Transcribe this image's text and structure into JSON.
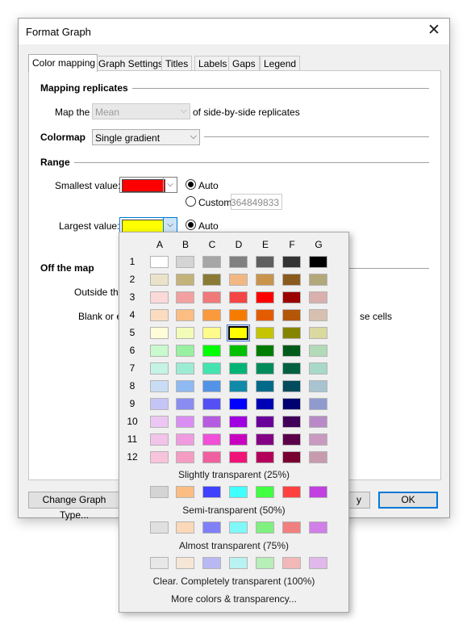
{
  "dialog": {
    "title": "Format Graph"
  },
  "tabs": [
    "Color mapping",
    "Graph Settings",
    "Titles",
    "Labels",
    "Gaps",
    "Legend"
  ],
  "mapping": {
    "section": "Mapping replicates",
    "map_the": "Map the",
    "value": "Mean",
    "suffix": "of side-by-side replicates"
  },
  "colormap": {
    "label": "Colormap",
    "value": "Single gradient"
  },
  "range": {
    "section": "Range",
    "smallest_label": "Smallest value:",
    "smallest_color": "#ff0000",
    "auto": "Auto",
    "custom": "Custom",
    "custom_value": "364849833",
    "largest_label": "Largest value:",
    "largest_color": "#ffff00"
  },
  "offmap": {
    "section": "Off the map",
    "outside": "Outside the",
    "blank": "Blank or ex",
    "blank_suffix": "se cells"
  },
  "buttons": {
    "change_graph_type": "Change Graph Type...",
    "apply": "y",
    "ok": "OK"
  },
  "palette": {
    "columns": [
      "A",
      "B",
      "C",
      "D",
      "E",
      "F",
      "G"
    ],
    "rows": [
      {
        "label": "1",
        "colors": [
          "#ffffff",
          "#d4d4d4",
          "#a6a6a6",
          "#808080",
          "#5f5f5f",
          "#333333",
          "#000000"
        ]
      },
      {
        "label": "2",
        "colors": [
          "#ebe3c9",
          "#c4b27b",
          "#8a7a36",
          "#f2b883",
          "#c8944c",
          "#8b5a1e",
          "#b3a87a"
        ]
      },
      {
        "label": "3",
        "colors": [
          "#fbd9d9",
          "#f3a0a0",
          "#f07a7a",
          "#f54545",
          "#ff0000",
          "#9b0000",
          "#d9b0ae"
        ]
      },
      {
        "label": "4",
        "colors": [
          "#fbdcc0",
          "#fbbd82",
          "#fa9a3c",
          "#f57c00",
          "#e45c00",
          "#b45608",
          "#d8c0b0"
        ]
      },
      {
        "label": "5",
        "colors": [
          "#fffdd8",
          "#f3fbb8",
          "#fcfb8c",
          "#ffff00",
          "#c4c400",
          "#858500",
          "#d9d9a0"
        ]
      },
      {
        "label": "6",
        "colors": [
          "#c8facd",
          "#98f0a0",
          "#00ff00",
          "#00c000",
          "#007c00",
          "#005a1a",
          "#b3dab8"
        ]
      },
      {
        "label": "7",
        "colors": [
          "#c5f3e5",
          "#9cecd4",
          "#45e3b0",
          "#00b476",
          "#008c5a",
          "#006040",
          "#a8d8c8"
        ]
      },
      {
        "label": "8",
        "colors": [
          "#cadcf3",
          "#8fb9f2",
          "#5393e6",
          "#108aa8",
          "#00698a",
          "#004c5c",
          "#a8c4d0"
        ]
      },
      {
        "label": "9",
        "colors": [
          "#c4c5f6",
          "#8a8cf2",
          "#5450f4",
          "#0000ff",
          "#0000b4",
          "#000070",
          "#8f9acf"
        ]
      },
      {
        "label": "10",
        "colors": [
          "#ecc7f3",
          "#da8ef2",
          "#b65ce0",
          "#a000e0",
          "#6a009a",
          "#40005a",
          "#b88ac8"
        ]
      },
      {
        "label": "11",
        "colors": [
          "#f3c4ea",
          "#f09be0",
          "#f050d8",
          "#c800c0",
          "#840084",
          "#5a0048",
          "#c89ac0"
        ]
      },
      {
        "label": "12",
        "colors": [
          "#f8c4dc",
          "#f59cc4",
          "#f060a0",
          "#f01478",
          "#b4005a",
          "#780030",
          "#c89aae"
        ]
      }
    ],
    "transparency": [
      {
        "label": "Slightly transparent (25%)",
        "colors": [
          "#d4d4d4",
          "#fbbd82",
          "#4040ff",
          "#40ffff",
          "#40ff40",
          "#ff4040",
          "#c040e0"
        ]
      },
      {
        "label": "Semi-transparent (50%)",
        "colors": [
          "#e0e0e0",
          "#fad8b8",
          "#8080f8",
          "#80f8f8",
          "#80f080",
          "#f08080",
          "#d080e8"
        ]
      },
      {
        "label": "Almost transparent (75%)",
        "colors": [
          "#e8e8e8",
          "#f6e6d6",
          "#b8b8f2",
          "#b8f2f2",
          "#b8eeb8",
          "#f2b8b8",
          "#e0b8ec"
        ]
      },
      {
        "label": "Clear. Completely transparent (100%)",
        "colors": []
      }
    ],
    "more": "More colors & transparency...",
    "selected": {
      "row": 5,
      "col": "D"
    }
  }
}
